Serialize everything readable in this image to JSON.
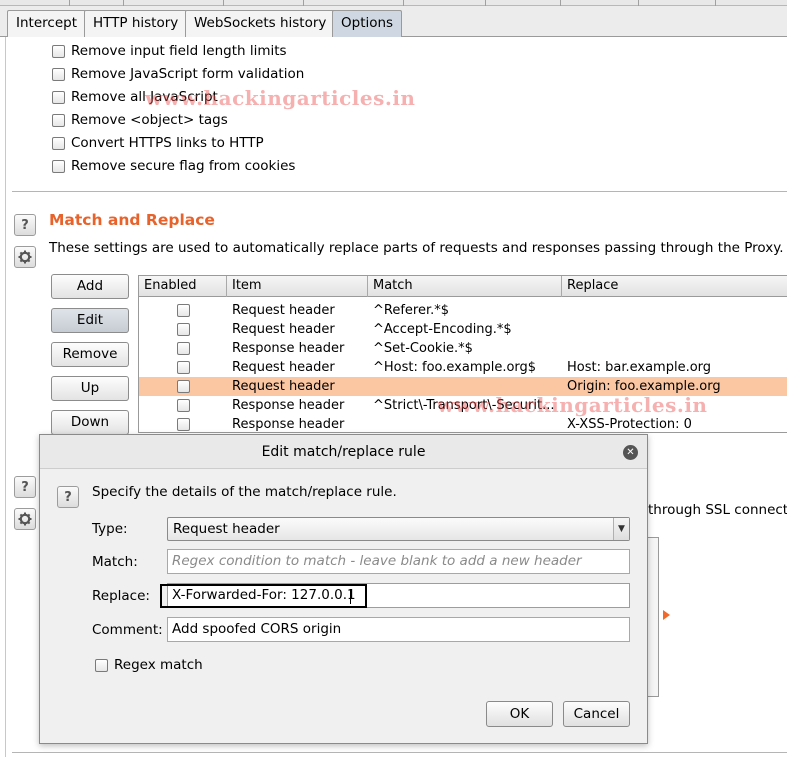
{
  "tabs": [
    "Intercept",
    "HTTP history",
    "WebSockets history",
    "Options"
  ],
  "options_checkboxes": [
    "Remove input field length limits",
    "Remove JavaScript form validation",
    "Remove all JavaScript",
    "Remove <object> tags",
    "Convert HTTPS links to HTTP",
    "Remove secure flag from cookies"
  ],
  "match_replace": {
    "title": "Match and Replace",
    "description": "These settings are used to automatically replace parts of requests and responses passing through the Proxy.",
    "buttons": [
      "Add",
      "Edit",
      "Remove",
      "Up",
      "Down"
    ],
    "columns": [
      "Enabled",
      "Item",
      "Match",
      "Replace"
    ],
    "rows": [
      {
        "item": "Request header",
        "match": "^Referer.*$",
        "replace": "",
        "selected": false
      },
      {
        "item": "Request header",
        "match": "^Accept-Encoding.*$",
        "replace": "",
        "selected": false
      },
      {
        "item": "Response header",
        "match": "^Set-Cookie.*$",
        "replace": "",
        "selected": false
      },
      {
        "item": "Request header",
        "match": "^Host: foo.example.org$",
        "replace": "Host: bar.example.org",
        "selected": false
      },
      {
        "item": "Request header",
        "match": "",
        "replace": "Origin: foo.example.org",
        "selected": true
      },
      {
        "item": "Response header",
        "match": "^Strict\\-Transport\\-Securit...",
        "replace": "",
        "selected": false
      },
      {
        "item": "Response header",
        "match": "",
        "replace": "X-XSS-Protection: 0",
        "selected": false
      }
    ]
  },
  "background_fragment": "through SSL connectio",
  "watermark": "www.hackingarticles.in",
  "dialog": {
    "title": "Edit match/replace rule",
    "instruction": "Specify the details of the match/replace rule.",
    "type_label": "Type:",
    "type_value": "Request header",
    "match_label": "Match:",
    "match_placeholder": "Regex condition to match - leave blank to add a new header",
    "replace_label": "Replace:",
    "replace_value": "X-Forwarded-For: 127.0.0.1",
    "comment_label": "Comment:",
    "comment_value": "Add spoofed CORS origin",
    "regex_label": "Regex match",
    "ok_label": "OK",
    "cancel_label": "Cancel"
  },
  "colors": {
    "accent": "#e8632b",
    "selected_row": "#fbc7a3"
  }
}
